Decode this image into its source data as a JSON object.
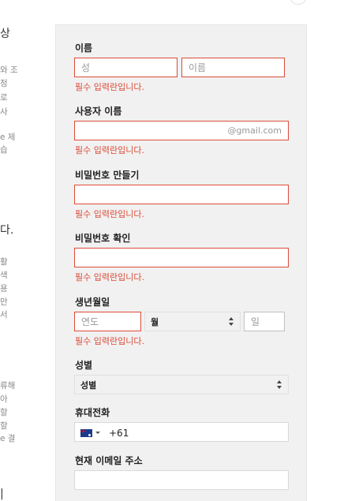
{
  "left_panel_fragments": [
    "상",
    "와 조",
    "정",
    "로",
    "사",
    "e 제",
    "습",
    "다.",
    "활",
    "색",
    "용",
    "만",
    "서",
    "류해",
    "아",
    "할",
    "할",
    "e 결",
    "|"
  ],
  "form": {
    "name": {
      "label": "이름",
      "last_placeholder": "성",
      "first_placeholder": "이름",
      "error": "필수 입력란입니다."
    },
    "username": {
      "label": "사용자 이름",
      "suffix": "@gmail.com",
      "error": "필수 입력란입니다."
    },
    "password": {
      "label": "비밀번호 만들기",
      "error": "필수 입력란입니다."
    },
    "password_confirm": {
      "label": "비밀번호 확인",
      "error": "필수 입력란입니다."
    },
    "birthday": {
      "label": "생년월일",
      "year_placeholder": "연도",
      "month_value": "월",
      "day_placeholder": "일",
      "error": "필수 입력란입니다."
    },
    "gender": {
      "label": "성별",
      "value": "성별"
    },
    "phone": {
      "label": "휴대전화",
      "country_icon": "australia-flag-icon",
      "value": "+61"
    },
    "current_email": {
      "label": "현재 이메일 주소",
      "value": ""
    }
  },
  "colors": {
    "error": "#dd4b39",
    "card_bg": "#f1f1f1"
  }
}
